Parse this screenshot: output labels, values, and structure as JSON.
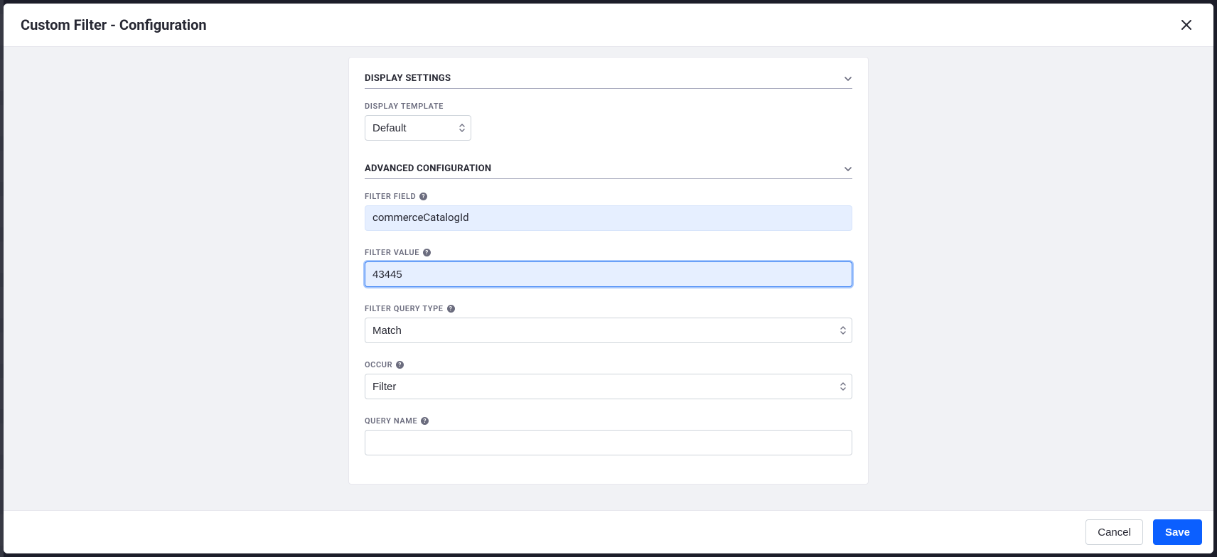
{
  "modal": {
    "title": "Custom Filter - Configuration"
  },
  "sections": {
    "display": {
      "title": "DISPLAY SETTINGS",
      "template_label": "DISPLAY TEMPLATE",
      "template_value": "Default"
    },
    "advanced": {
      "title": "ADVANCED CONFIGURATION",
      "filter_field_label": "FILTER FIELD",
      "filter_field_value": "commerceCatalogId",
      "filter_value_label": "FILTER VALUE",
      "filter_value_value": "43445",
      "filter_query_type_label": "FILTER QUERY TYPE",
      "filter_query_type_value": "Match",
      "occur_label": "OCCUR",
      "occur_value": "Filter",
      "query_name_label": "QUERY NAME"
    }
  },
  "footer": {
    "cancel": "Cancel",
    "save": "Save"
  }
}
